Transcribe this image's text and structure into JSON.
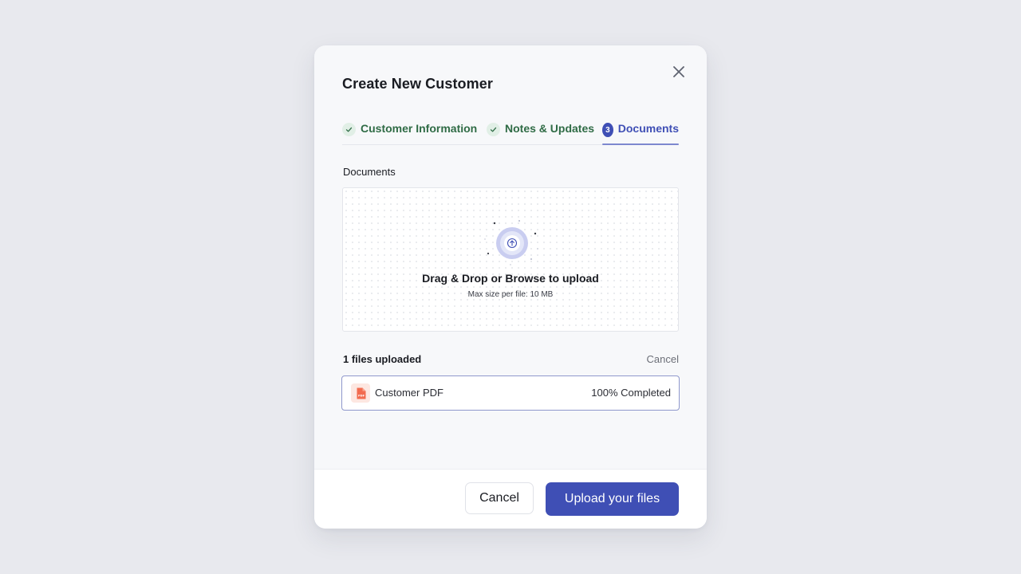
{
  "modal": {
    "title": "Create New Customer",
    "close_icon": "close-icon"
  },
  "steps": [
    {
      "label": "Customer Information",
      "state": "completed",
      "icon": "check-icon"
    },
    {
      "label": "Notes & Updates",
      "state": "completed",
      "icon": "check-icon"
    },
    {
      "label": "Documents",
      "state": "active",
      "number": "3"
    }
  ],
  "documents": {
    "label": "Documents",
    "dropzone": {
      "title": "Drag & Drop or Browse to upload",
      "subtitle": "Max size per file: 10 MB",
      "icon": "upload-icon"
    },
    "files_count_label": "1 files uploaded",
    "cancel_label": "Cancel",
    "files": [
      {
        "name": "Customer PDF",
        "status": "100% Completed",
        "progress": 1.0,
        "icon": "pdf-file-icon"
      }
    ]
  },
  "footer": {
    "cancel_label": "Cancel",
    "upload_label": "Upload your files"
  },
  "colors": {
    "accent": "#3f4fb5",
    "success": "#2f6b45",
    "pdf": "#f26b4f",
    "background": "#e8e9ee"
  }
}
